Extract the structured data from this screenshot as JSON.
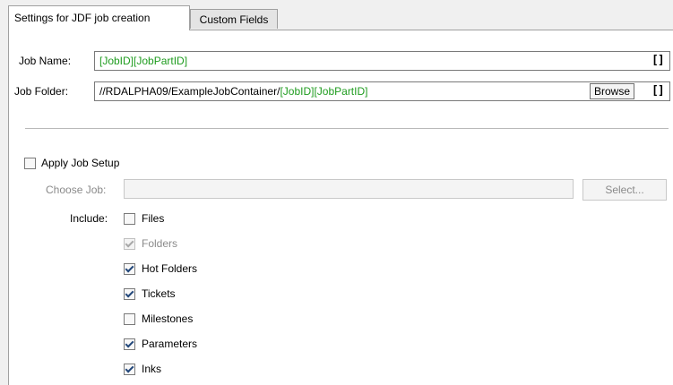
{
  "tabs": [
    {
      "label": "Settings for JDF job creation",
      "active": true
    },
    {
      "label": "Custom Fields",
      "active": false
    }
  ],
  "job_name": {
    "label": "Job Name:",
    "value_tokens": "[JobID][JobPartID]"
  },
  "job_folder": {
    "label": "Job Folder:",
    "value_prefix": "//RDALPHA09/ExampleJobContainer/",
    "value_tokens": "[JobID][JobPartID]",
    "browse_label": "Browse"
  },
  "token_icon": "[]",
  "apply_setup": {
    "label": "Apply Job Setup",
    "checked": false
  },
  "choose_job": {
    "label": "Choose Job:",
    "value": "",
    "select_label": "Select..."
  },
  "include": {
    "label": "Include:",
    "items": [
      {
        "label": "Files",
        "checked": false,
        "enabled": true
      },
      {
        "label": "Folders",
        "checked": true,
        "enabled": false
      },
      {
        "label": "Hot Folders",
        "checked": true,
        "enabled": true
      },
      {
        "label": "Tickets",
        "checked": true,
        "enabled": true
      },
      {
        "label": "Milestones",
        "checked": false,
        "enabled": true
      },
      {
        "label": "Parameters",
        "checked": true,
        "enabled": true
      },
      {
        "label": "Inks",
        "checked": true,
        "enabled": true
      }
    ]
  },
  "colors": {
    "token_green": "#1f9c1f",
    "check_blue": "#22477a"
  }
}
